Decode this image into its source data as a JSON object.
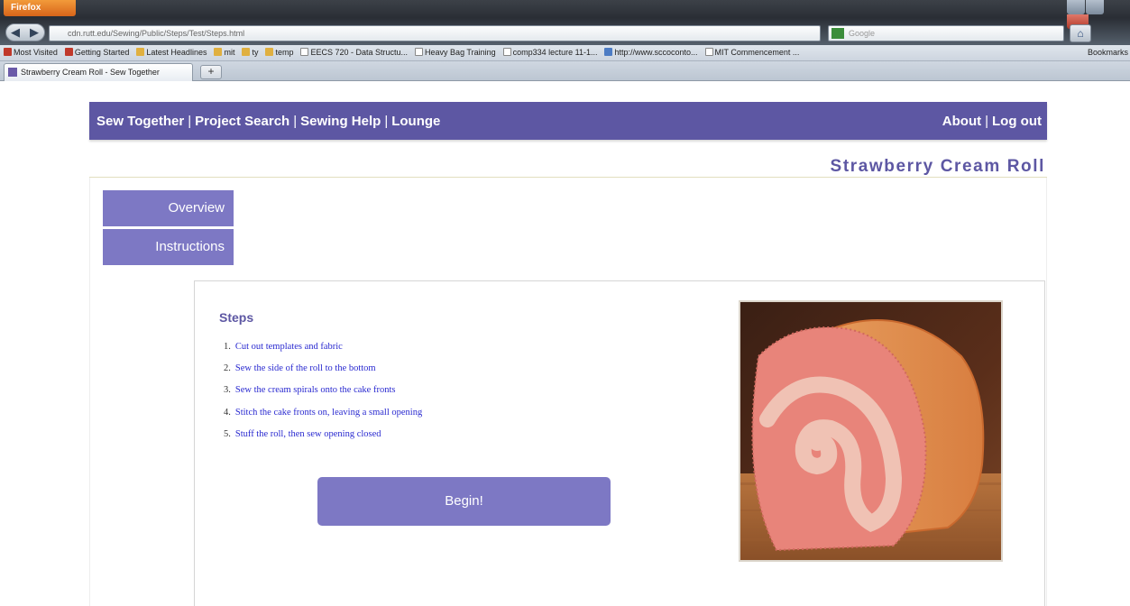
{
  "browser": {
    "app_button": "Firefox",
    "url": "cdn.rutt.edu/Sewing/Public/Steps/Test/Steps.html",
    "search_placeholder": "Google",
    "tab_title": "Strawberry Cream Roll - Sew Together",
    "new_tab_label": "+",
    "bookmarks": [
      {
        "label": "Most Visited",
        "icon": "bookmark-icon"
      },
      {
        "label": "Getting Started",
        "icon": "bookmark-icon"
      },
      {
        "label": "Latest Headlines",
        "icon": "rss-icon"
      },
      {
        "label": "mit",
        "icon": "folder-icon"
      },
      {
        "label": "ty",
        "icon": "folder-icon"
      },
      {
        "label": "temp",
        "icon": "folder-icon"
      },
      {
        "label": "EECS 720 - Data Structu...",
        "icon": "page-icon"
      },
      {
        "label": "Heavy Bag Training",
        "icon": "page-icon"
      },
      {
        "label": "comp334 lecture 11-1...",
        "icon": "page-icon"
      },
      {
        "label": "http://www.sccoconto...",
        "icon": "globe-icon"
      },
      {
        "label": "MIT Commencement ...",
        "icon": "page-icon"
      }
    ],
    "bookmarks_menu": "Bookmarks"
  },
  "site": {
    "nav_left": [
      {
        "label": "Sew Together"
      },
      {
        "label": "Project Search"
      },
      {
        "label": "Sewing Help"
      },
      {
        "label": "Lounge"
      }
    ],
    "nav_right": [
      {
        "label": "About"
      },
      {
        "label": "Log out"
      }
    ],
    "separator": "|",
    "project_title": "Strawberry Cream Roll",
    "side_tabs": {
      "overview": "Overview",
      "instructions": "Instructions"
    },
    "steps_heading": "Steps",
    "steps": [
      {
        "num": "1.",
        "text": "Cut out templates and fabric"
      },
      {
        "num": "2.",
        "text": "Sew the side of the roll to the bottom"
      },
      {
        "num": "3.",
        "text": "Sew the cream spirals onto the cake fronts"
      },
      {
        "num": "4.",
        "text": "Stitch the cake fronts on, leaving a small opening"
      },
      {
        "num": "5.",
        "text": "Stuff the roll, then sew opening closed"
      }
    ],
    "begin_label": "Begin!"
  },
  "colors": {
    "brand_purple": "#5d57a3",
    "tab_purple": "#7d78c4",
    "step_link": "#2a2ad0"
  }
}
